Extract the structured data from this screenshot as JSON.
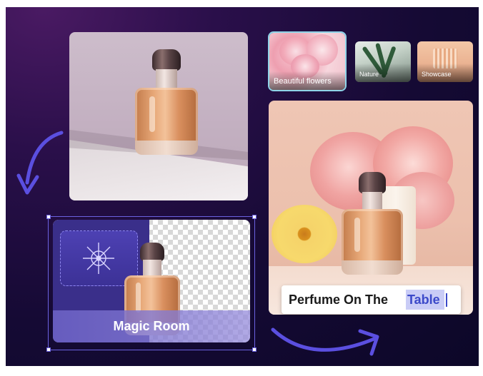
{
  "thumbnails": [
    {
      "label": "Beautiful flowers"
    },
    {
      "label": "Nature"
    },
    {
      "label": "Showcase"
    }
  ],
  "caption": {
    "prefix": "Perfume On The",
    "highlight": "Table"
  },
  "magic_room": {
    "label": "Magic Room"
  },
  "colors": {
    "background": "#150a34",
    "accent": "#5b4fe0",
    "selection": "#8fd4e8",
    "highlight": "#c9ccf6"
  }
}
